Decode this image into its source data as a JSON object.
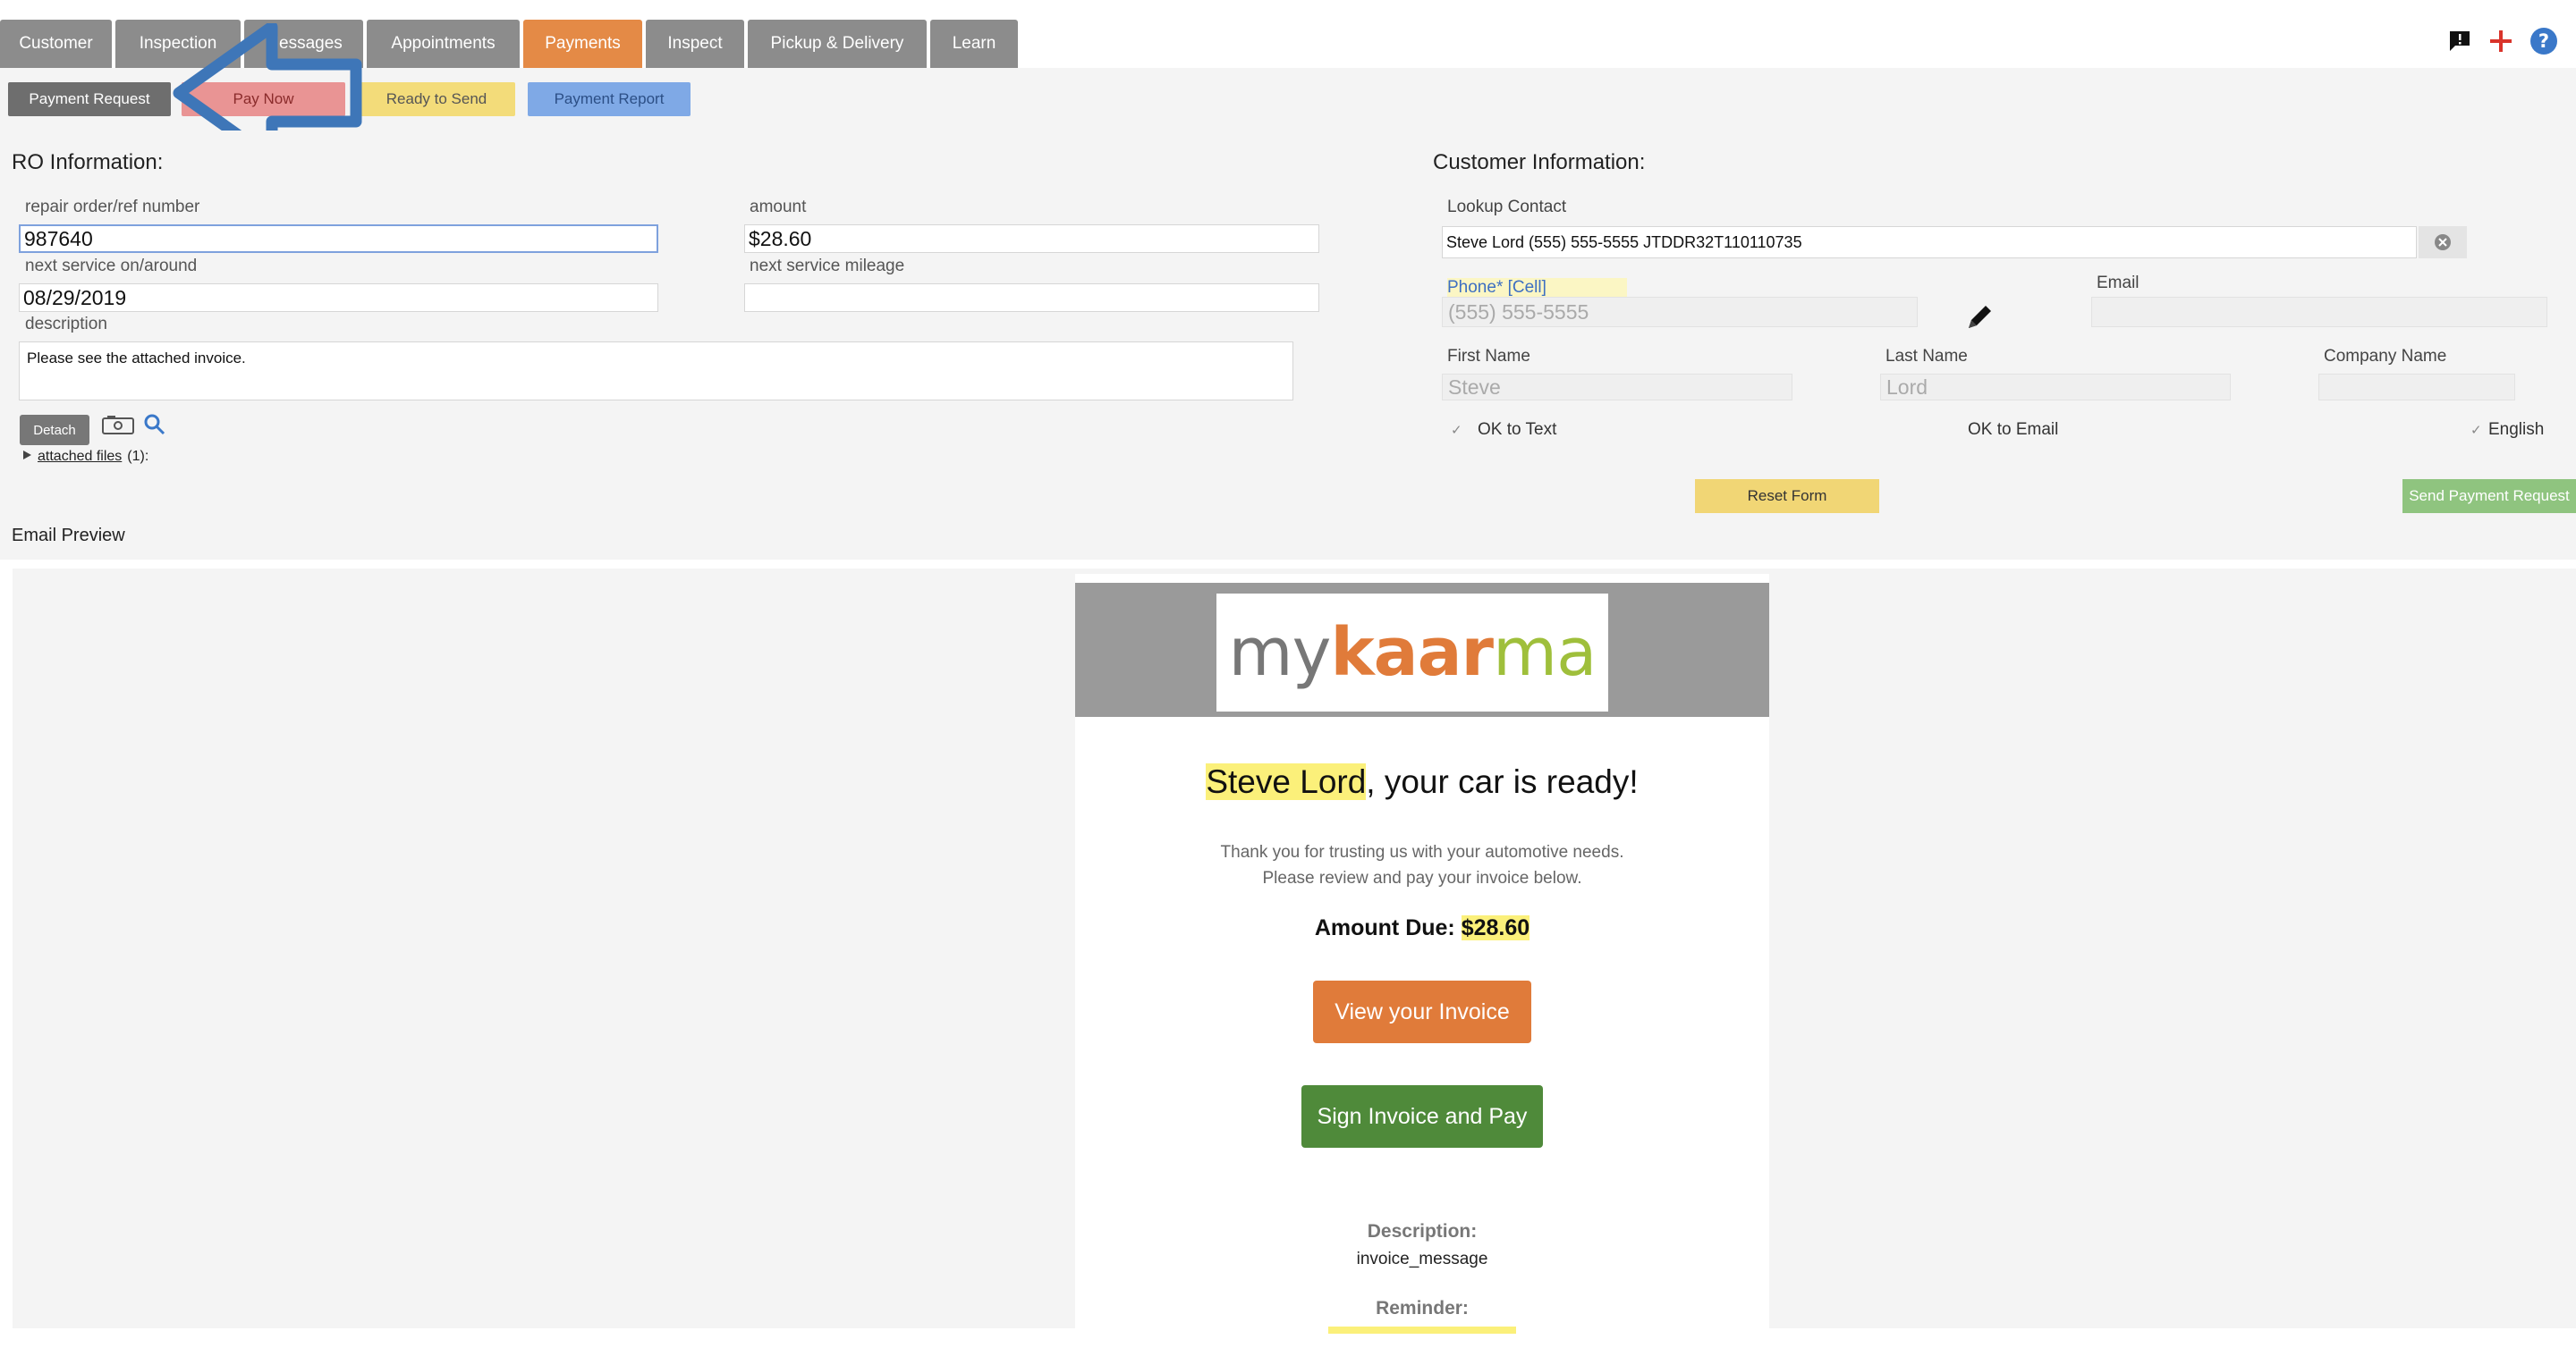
{
  "tabs": [
    "Customer",
    "Inspection",
    "Messages",
    "Appointments",
    "Payments",
    "Inspect",
    "Pickup & Delivery",
    "Learn"
  ],
  "active_tab": "Payments",
  "subbar": {
    "payment_request": "Payment Request",
    "pay_now": "Pay Now",
    "ready_to_send": "Ready to Send",
    "payment_report": "Payment Report"
  },
  "ro": {
    "title": "RO Information:",
    "repair_order_label": "repair order/ref number",
    "repair_order_value": "987640",
    "amount_label": "amount",
    "amount_value": "$28.60",
    "next_service_label": "next service on/around",
    "next_service_value": "08/29/2019",
    "next_mileage_label": "next service mileage",
    "next_mileage_value": "",
    "description_label": "description",
    "description_value": "Please see the attached invoice.",
    "detach_label": "Detach",
    "attached_files_label": "attached files",
    "attached_files_count": "(1):"
  },
  "customer": {
    "title": "Customer Information:",
    "lookup_label": "Lookup Contact",
    "lookup_value": "Steve Lord (555) 555-5555 JTDDR32T110110735",
    "phone_label": "Phone* [Cell]",
    "phone_value": "(555) 555-5555",
    "email_label": "Email",
    "email_value": "",
    "first_name_label": "First Name",
    "first_name_value": "Steve",
    "last_name_label": "Last Name",
    "last_name_value": "Lord",
    "company_label": "Company Name",
    "company_value": "",
    "ok_to_text": "OK to Text",
    "ok_to_email": "OK to Email",
    "language": "English",
    "reset_form": "Reset Form",
    "send_payment_request": "Send Payment Request"
  },
  "email_preview": {
    "label": "Email Preview",
    "logo_my": "my",
    "logo_kaar": "kaar",
    "logo_ma": "ma",
    "headline_name": "Steve Lord",
    "headline_rest": ", your car is ready!",
    "thanks_line1": "Thank you for trusting us with your automotive needs.",
    "thanks_line2": "Please review and pay your invoice below.",
    "amount_due_label": "Amount Due:",
    "amount_due_value": "$28.60",
    "view_invoice": "View your Invoice",
    "sign_and_pay": "Sign Invoice and Pay",
    "description_label": "Description:",
    "description_value": "invoice_message",
    "reminder_label": "Reminder:"
  },
  "colors": {
    "tab_gray": "#8c8c8c",
    "tab_active": "#e48a46",
    "pay_now": "#e99494",
    "ready_to_send": "#f3dc7a",
    "payment_report": "#7fa9e6",
    "payment_request": "#6e6e6e",
    "arrow": "#3e76b8",
    "view_invoice": "#e07b3a",
    "sign_and_pay": "#4f8a3a"
  },
  "icons": [
    "feedback-icon",
    "plus-icon",
    "help-icon",
    "camera-icon",
    "zoom-icon",
    "pencil-icon",
    "clear-icon",
    "expand-triangle-icon",
    "arrow-pointer"
  ]
}
